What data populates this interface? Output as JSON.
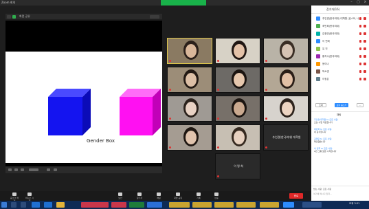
{
  "window": {
    "title": "Zoom 회의"
  },
  "share": {
    "top_label": "화면 공유",
    "shape_label": "Gender Box",
    "cube_colors": {
      "blue": "#1414f0",
      "magenta": "#ff10f2"
    }
  },
  "gallery": {
    "tiles": [
      {
        "kind": "video",
        "bg": "#8a7a62",
        "face": "#d9b79a",
        "hair": "#2b201a",
        "active": true
      },
      {
        "kind": "video",
        "bg": "#d7d2c6",
        "face": "#e3c2a8",
        "hair": "#1f1612",
        "active": false
      },
      {
        "kind": "video",
        "bg": "#b9b3a7",
        "face": "#d6c3b3",
        "hair": "#3a2e25",
        "active": false
      },
      {
        "kind": "video",
        "bg": "#9c8d78",
        "face": "#dcbfa6",
        "hair": "#231a14",
        "active": false
      },
      {
        "kind": "video",
        "bg": "#6d6a66",
        "face": "#e6c7ad",
        "hair": "#1b1410",
        "active": false
      },
      {
        "kind": "video",
        "bg": "#b3a795",
        "face": "#e2c0a5",
        "hair": "#2a1e17",
        "active": false
      },
      {
        "kind": "video",
        "bg": "#9f9a94",
        "face": "#e8d2c4",
        "hair": "#2b221c",
        "active": false
      },
      {
        "kind": "video",
        "bg": "#777069",
        "face": "#caa98f",
        "hair": "#1c1511",
        "active": false
      },
      {
        "kind": "video",
        "bg": "#d7d3cd",
        "face": "#ecd4c2",
        "hair": "#2d231d",
        "active": false
      },
      {
        "kind": "video",
        "bg": "#a59c92",
        "face": "#e0c3ad",
        "hair": "#1f1712",
        "active": false
      },
      {
        "kind": "video",
        "bg": "#c7bfb3",
        "face": "#e7d1c0",
        "hair": "#35291f",
        "active": false
      },
      {
        "kind": "name",
        "bg": "#2a2a2a",
        "label": "추인경(한국외대) 대학원"
      },
      {
        "kind": "name",
        "bg": "#2a2a2a",
        "label": "이 명 희"
      }
    ]
  },
  "toolbar": {
    "items": [
      "음소거 해제",
      "비디오 시작",
      "보안",
      "참가자",
      "채팅",
      "화면 공유",
      "기록",
      "반응"
    ],
    "end_label": "종료"
  },
  "panel": {
    "title": "참가자(16)",
    "participants": [
      {
        "name": "추인경(한국외대) 대학원 (호스트, 나)",
        "color": "#2d8cff"
      },
      {
        "name": "최민희(한국외대)",
        "color": "#4caf50"
      },
      {
        "name": "김정민(한국외대)",
        "color": "#00b2a9"
      },
      {
        "name": "이 연희",
        "color": "#2d8cff"
      },
      {
        "name": "유 진",
        "color": "#8bc34a"
      },
      {
        "name": "황지수(한국외대)",
        "color": "#9c27b0"
      },
      {
        "name": "윤이나",
        "color": "#ff9800"
      },
      {
        "name": "박소영",
        "color": "#795548"
      },
      {
        "name": "이정은",
        "color": "#607d8b"
      }
    ],
    "buttons": [
      "초대",
      "모두 음소거",
      "..."
    ],
    "chat_title": "채팅",
    "messages": [
      {
        "from": "추인경 대학원 to 모든 사람:",
        "body": "오늘 수업 자료입니다"
      },
      {
        "from": "최민희 to 모든 사람:",
        "body": "네 감사합니다"
      },
      {
        "from": "김정민 to 모든 사람:",
        "body": "확인했습니다"
      },
      {
        "from": "이 연희 to 모든 사람:",
        "body": "2번 그룹 토론 시작합니다"
      }
    ],
    "chat_to": "받는 사람: 모든 사람",
    "chat_placeholder": "여기에 메시지 입력..."
  },
  "taskbar": {
    "clock": "오후 3:21"
  }
}
